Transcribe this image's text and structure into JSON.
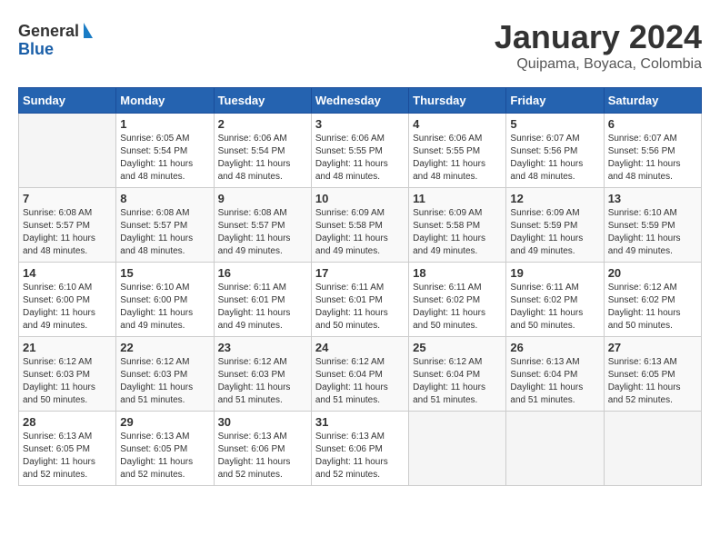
{
  "logo": {
    "line1": "General",
    "line2": "Blue"
  },
  "title": "January 2024",
  "subtitle": "Quipama, Boyaca, Colombia",
  "days_header": [
    "Sunday",
    "Monday",
    "Tuesday",
    "Wednesday",
    "Thursday",
    "Friday",
    "Saturday"
  ],
  "weeks": [
    [
      {
        "day": "",
        "sunrise": "",
        "sunset": "",
        "daylight": ""
      },
      {
        "day": "1",
        "sunrise": "Sunrise: 6:05 AM",
        "sunset": "Sunset: 5:54 PM",
        "daylight": "Daylight: 11 hours and 48 minutes."
      },
      {
        "day": "2",
        "sunrise": "Sunrise: 6:06 AM",
        "sunset": "Sunset: 5:54 PM",
        "daylight": "Daylight: 11 hours and 48 minutes."
      },
      {
        "day": "3",
        "sunrise": "Sunrise: 6:06 AM",
        "sunset": "Sunset: 5:55 PM",
        "daylight": "Daylight: 11 hours and 48 minutes."
      },
      {
        "day": "4",
        "sunrise": "Sunrise: 6:06 AM",
        "sunset": "Sunset: 5:55 PM",
        "daylight": "Daylight: 11 hours and 48 minutes."
      },
      {
        "day": "5",
        "sunrise": "Sunrise: 6:07 AM",
        "sunset": "Sunset: 5:56 PM",
        "daylight": "Daylight: 11 hours and 48 minutes."
      },
      {
        "day": "6",
        "sunrise": "Sunrise: 6:07 AM",
        "sunset": "Sunset: 5:56 PM",
        "daylight": "Daylight: 11 hours and 48 minutes."
      }
    ],
    [
      {
        "day": "7",
        "sunrise": "Sunrise: 6:08 AM",
        "sunset": "Sunset: 5:57 PM",
        "daylight": "Daylight: 11 hours and 48 minutes."
      },
      {
        "day": "8",
        "sunrise": "Sunrise: 6:08 AM",
        "sunset": "Sunset: 5:57 PM",
        "daylight": "Daylight: 11 hours and 48 minutes."
      },
      {
        "day": "9",
        "sunrise": "Sunrise: 6:08 AM",
        "sunset": "Sunset: 5:57 PM",
        "daylight": "Daylight: 11 hours and 49 minutes."
      },
      {
        "day": "10",
        "sunrise": "Sunrise: 6:09 AM",
        "sunset": "Sunset: 5:58 PM",
        "daylight": "Daylight: 11 hours and 49 minutes."
      },
      {
        "day": "11",
        "sunrise": "Sunrise: 6:09 AM",
        "sunset": "Sunset: 5:58 PM",
        "daylight": "Daylight: 11 hours and 49 minutes."
      },
      {
        "day": "12",
        "sunrise": "Sunrise: 6:09 AM",
        "sunset": "Sunset: 5:59 PM",
        "daylight": "Daylight: 11 hours and 49 minutes."
      },
      {
        "day": "13",
        "sunrise": "Sunrise: 6:10 AM",
        "sunset": "Sunset: 5:59 PM",
        "daylight": "Daylight: 11 hours and 49 minutes."
      }
    ],
    [
      {
        "day": "14",
        "sunrise": "Sunrise: 6:10 AM",
        "sunset": "Sunset: 6:00 PM",
        "daylight": "Daylight: 11 hours and 49 minutes."
      },
      {
        "day": "15",
        "sunrise": "Sunrise: 6:10 AM",
        "sunset": "Sunset: 6:00 PM",
        "daylight": "Daylight: 11 hours and 49 minutes."
      },
      {
        "day": "16",
        "sunrise": "Sunrise: 6:11 AM",
        "sunset": "Sunset: 6:01 PM",
        "daylight": "Daylight: 11 hours and 49 minutes."
      },
      {
        "day": "17",
        "sunrise": "Sunrise: 6:11 AM",
        "sunset": "Sunset: 6:01 PM",
        "daylight": "Daylight: 11 hours and 50 minutes."
      },
      {
        "day": "18",
        "sunrise": "Sunrise: 6:11 AM",
        "sunset": "Sunset: 6:02 PM",
        "daylight": "Daylight: 11 hours and 50 minutes."
      },
      {
        "day": "19",
        "sunrise": "Sunrise: 6:11 AM",
        "sunset": "Sunset: 6:02 PM",
        "daylight": "Daylight: 11 hours and 50 minutes."
      },
      {
        "day": "20",
        "sunrise": "Sunrise: 6:12 AM",
        "sunset": "Sunset: 6:02 PM",
        "daylight": "Daylight: 11 hours and 50 minutes."
      }
    ],
    [
      {
        "day": "21",
        "sunrise": "Sunrise: 6:12 AM",
        "sunset": "Sunset: 6:03 PM",
        "daylight": "Daylight: 11 hours and 50 minutes."
      },
      {
        "day": "22",
        "sunrise": "Sunrise: 6:12 AM",
        "sunset": "Sunset: 6:03 PM",
        "daylight": "Daylight: 11 hours and 51 minutes."
      },
      {
        "day": "23",
        "sunrise": "Sunrise: 6:12 AM",
        "sunset": "Sunset: 6:03 PM",
        "daylight": "Daylight: 11 hours and 51 minutes."
      },
      {
        "day": "24",
        "sunrise": "Sunrise: 6:12 AM",
        "sunset": "Sunset: 6:04 PM",
        "daylight": "Daylight: 11 hours and 51 minutes."
      },
      {
        "day": "25",
        "sunrise": "Sunrise: 6:12 AM",
        "sunset": "Sunset: 6:04 PM",
        "daylight": "Daylight: 11 hours and 51 minutes."
      },
      {
        "day": "26",
        "sunrise": "Sunrise: 6:13 AM",
        "sunset": "Sunset: 6:04 PM",
        "daylight": "Daylight: 11 hours and 51 minutes."
      },
      {
        "day": "27",
        "sunrise": "Sunrise: 6:13 AM",
        "sunset": "Sunset: 6:05 PM",
        "daylight": "Daylight: 11 hours and 52 minutes."
      }
    ],
    [
      {
        "day": "28",
        "sunrise": "Sunrise: 6:13 AM",
        "sunset": "Sunset: 6:05 PM",
        "daylight": "Daylight: 11 hours and 52 minutes."
      },
      {
        "day": "29",
        "sunrise": "Sunrise: 6:13 AM",
        "sunset": "Sunset: 6:05 PM",
        "daylight": "Daylight: 11 hours and 52 minutes."
      },
      {
        "day": "30",
        "sunrise": "Sunrise: 6:13 AM",
        "sunset": "Sunset: 6:06 PM",
        "daylight": "Daylight: 11 hours and 52 minutes."
      },
      {
        "day": "31",
        "sunrise": "Sunrise: 6:13 AM",
        "sunset": "Sunset: 6:06 PM",
        "daylight": "Daylight: 11 hours and 52 minutes."
      },
      {
        "day": "",
        "sunrise": "",
        "sunset": "",
        "daylight": ""
      },
      {
        "day": "",
        "sunrise": "",
        "sunset": "",
        "daylight": ""
      },
      {
        "day": "",
        "sunrise": "",
        "sunset": "",
        "daylight": ""
      }
    ]
  ]
}
